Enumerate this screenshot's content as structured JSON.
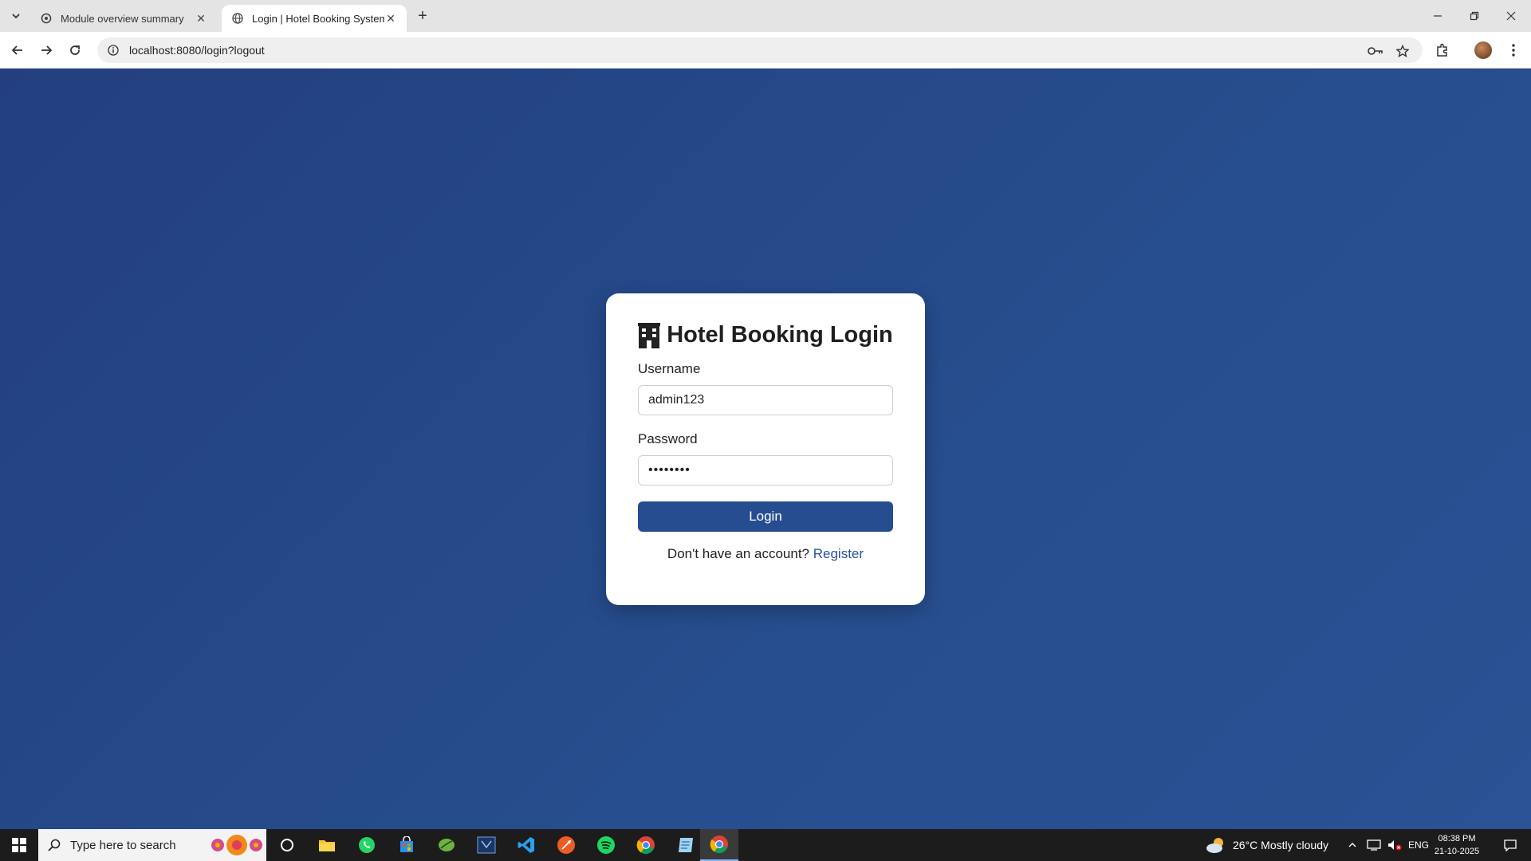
{
  "browser": {
    "tabs": [
      {
        "title": "Module overview summary",
        "active": false
      },
      {
        "title": "Login | Hotel Booking System",
        "active": true
      }
    ],
    "url": "localhost:8080/login?logout"
  },
  "login": {
    "title": "Hotel Booking Login",
    "username_label": "Username",
    "username_value": "admin123",
    "password_label": "Password",
    "password_value": "••••••••",
    "login_button": "Login",
    "register_prompt": "Don't have an account?",
    "register_link": "Register"
  },
  "taskbar": {
    "search_placeholder": "Type here to search",
    "weather": "26°C  Mostly cloudy",
    "language": "ENG",
    "time": "08:38 PM",
    "date": "21-10-2025"
  },
  "colors": {
    "page_bg": "#234a87",
    "button": "#264d8f",
    "link": "#2a5294"
  }
}
